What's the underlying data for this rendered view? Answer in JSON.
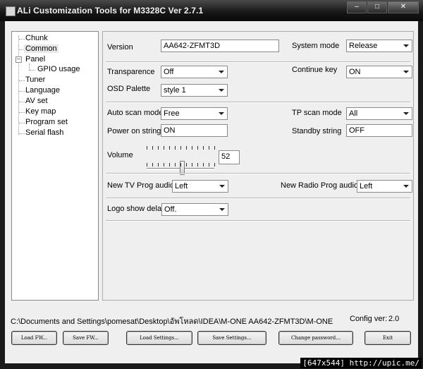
{
  "window": {
    "title": "ALi Customization Tools for M3328C  Ver 2.7.1",
    "controls": {
      "minimize": "–",
      "maximize": "□",
      "close": "✕"
    }
  },
  "tree": {
    "items": [
      {
        "label": "Chunk"
      },
      {
        "label": "Common",
        "selected": true
      },
      {
        "label": "Panel",
        "expander": "–"
      },
      {
        "label": "GPIO usage"
      },
      {
        "label": "Tuner"
      },
      {
        "label": "Language"
      },
      {
        "label": "AV set"
      },
      {
        "label": "Key map"
      },
      {
        "label": "Program set"
      },
      {
        "label": "Serial flash"
      }
    ]
  },
  "form": {
    "version": {
      "label": "Version",
      "value": "AA642-ZFMT3D"
    },
    "system_mode": {
      "label": "System mode",
      "value": "Release"
    },
    "transparence": {
      "label": "Transparence",
      "value": "Off"
    },
    "continue_key": {
      "label": "Continue key",
      "value": "ON"
    },
    "osd_palette": {
      "label": "OSD Palette",
      "value": "style 1"
    },
    "auto_scan_mode": {
      "label": "Auto scan mode",
      "value": "Free"
    },
    "tp_scan_mode": {
      "label": "TP scan mode",
      "value": "All"
    },
    "power_on_string": {
      "label": "Power on string",
      "value": "ON"
    },
    "standby_string": {
      "label": "Standby string",
      "value": "OFF"
    },
    "volume": {
      "label": "Volume",
      "value": "52"
    },
    "new_tv_prog_audio": {
      "label": "New TV Prog audio",
      "value": "Left"
    },
    "new_radio_prog_audio": {
      "label": "New Radio Prog audio",
      "value": "Left"
    },
    "logo_show_delay": {
      "label": "Logo show delay",
      "value": "Off."
    }
  },
  "status": {
    "path": "C:\\Documents and Settings\\pomesat\\Desktop\\อัพโหลด\\IDEA\\M-ONE AA642-ZFMT3D\\M-ONE",
    "config_label": "Config ver:",
    "config_value": "2.0"
  },
  "buttons": {
    "load_fw": "Load FW...",
    "save_fw": "Save FW...",
    "load_settings": "Load Settings...",
    "save_settings": "Save Settings...",
    "change_password": "Change password...",
    "exit": "Exit"
  },
  "watermark": "[647x544] http://upic.me/"
}
